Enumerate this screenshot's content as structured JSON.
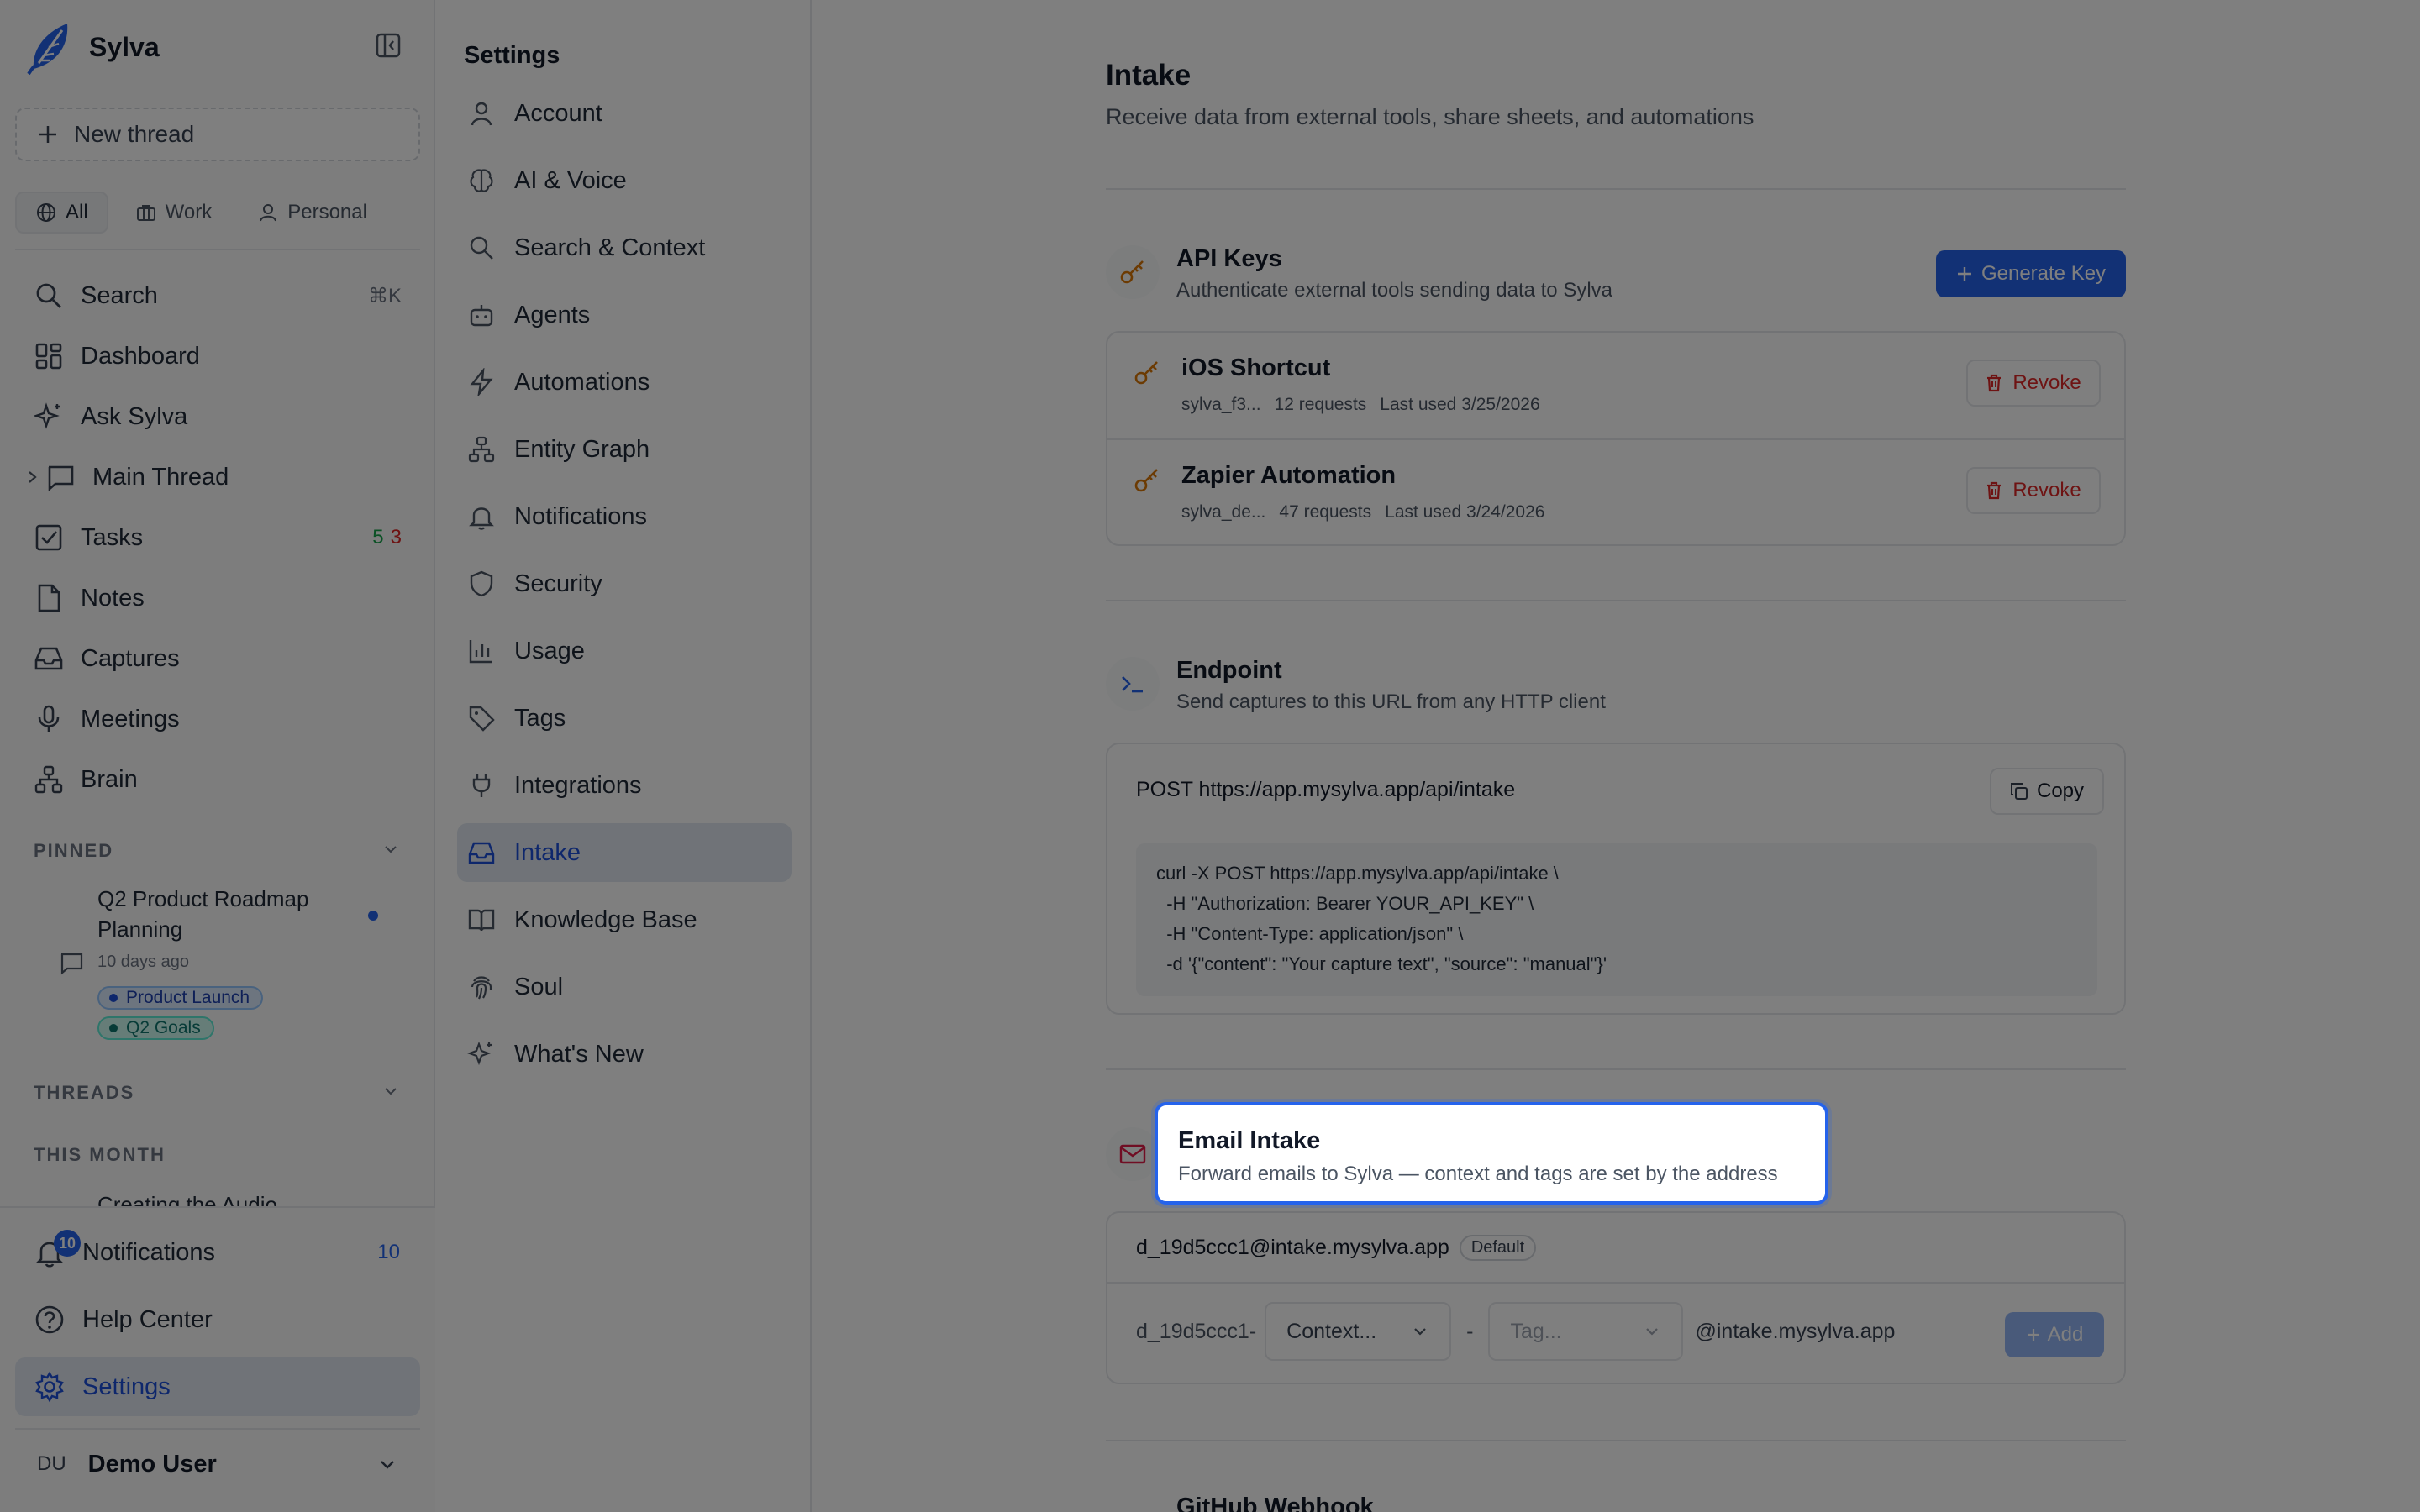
{
  "app": {
    "name": "Sylva"
  },
  "sidebar": {
    "new_thread_label": "New thread",
    "filters": [
      {
        "label": "All",
        "icon": "globe-icon",
        "active": true
      },
      {
        "label": "Work",
        "icon": "briefcase-icon",
        "active": false
      },
      {
        "label": "Personal",
        "icon": "person-icon",
        "active": false
      }
    ],
    "nav": [
      {
        "label": "Search",
        "icon": "search-icon",
        "shortcut": "⌘K"
      },
      {
        "label": "Dashboard",
        "icon": "dashboard-icon"
      },
      {
        "label": "Ask Sylva",
        "icon": "sparkles-icon"
      },
      {
        "label": "Main Thread",
        "icon": "chat-icon"
      },
      {
        "label": "Tasks",
        "icon": "checkbox-icon",
        "count_open": "5",
        "count_overdue": "3"
      },
      {
        "label": "Notes",
        "icon": "file-icon"
      },
      {
        "label": "Captures",
        "icon": "inbox-icon"
      },
      {
        "label": "Meetings",
        "icon": "mic-icon"
      },
      {
        "label": "Brain",
        "icon": "network-icon"
      }
    ],
    "pinned_label": "PINNED",
    "pinned_item": {
      "title": "Q2 Product Roadmap Planning",
      "date": "10 days ago",
      "tags": [
        "Product Launch",
        "Q2 Goals"
      ]
    },
    "threads_label": "THREADS",
    "this_month_label": "THIS MONTH",
    "thread_partial": "Creating the Audio",
    "bottom": {
      "notifications_label": "Notifications",
      "notifications_badge": "10",
      "notifications_count": "10",
      "help_label": "Help Center",
      "settings_label": "Settings"
    },
    "user": {
      "initials": "DU",
      "name": "Demo User"
    }
  },
  "settings_nav": {
    "title": "Settings",
    "items": [
      {
        "label": "Account",
        "icon": "user-icon"
      },
      {
        "label": "AI & Voice",
        "icon": "brain-icon"
      },
      {
        "label": "Search & Context",
        "icon": "search-icon"
      },
      {
        "label": "Agents",
        "icon": "bot-icon"
      },
      {
        "label": "Automations",
        "icon": "zap-icon"
      },
      {
        "label": "Entity Graph",
        "icon": "network-icon"
      },
      {
        "label": "Notifications",
        "icon": "bell-icon"
      },
      {
        "label": "Security",
        "icon": "shield-icon"
      },
      {
        "label": "Usage",
        "icon": "bar-chart-icon"
      },
      {
        "label": "Tags",
        "icon": "tag-icon"
      },
      {
        "label": "Integrations",
        "icon": "plug-icon"
      },
      {
        "label": "Intake",
        "icon": "inbox-icon",
        "active": true
      },
      {
        "label": "Knowledge Base",
        "icon": "book-icon"
      },
      {
        "label": "Soul",
        "icon": "fingerprint-icon"
      },
      {
        "label": "What's New",
        "icon": "sparkles-icon"
      }
    ]
  },
  "main": {
    "title": "Intake",
    "subtitle": "Receive data from external tools, share sheets, and automations",
    "api_keys": {
      "title": "API Keys",
      "subtitle": "Authenticate external tools sending data to Sylva",
      "generate_label": "Generate Key",
      "revoke_label": "Revoke",
      "keys": [
        {
          "name": "iOS Shortcut",
          "prefix": "sylva_f3...",
          "requests": "12 requests",
          "last_used": "Last used 3/25/2026"
        },
        {
          "name": "Zapier Automation",
          "prefix": "sylva_de...",
          "requests": "47 requests",
          "last_used": "Last used 3/24/2026"
        }
      ]
    },
    "endpoint": {
      "title": "Endpoint",
      "subtitle": "Send captures to this URL from any HTTP client",
      "url": "POST https://app.mysylva.app/api/intake",
      "copy_label": "Copy",
      "code": [
        "curl -X POST https://app.mysylva.app/api/intake \\",
        "  -H \"Authorization: Bearer YOUR_API_KEY\" \\",
        "  -H \"Content-Type: application/json\" \\",
        "  -d '{\"content\": \"Your capture text\", \"source\": \"manual\"}'"
      ]
    },
    "email_intake": {
      "title": "Email Intake",
      "subtitle": "Forward emails to Sylva — context and tags are set by the address",
      "default_address": "d_19d5ccc1@intake.mysylva.app",
      "default_badge": "Default",
      "prefix": "d_19d5ccc1-",
      "context_placeholder": "Context...",
      "separator": "-",
      "tag_placeholder": "Tag...",
      "domain": "@intake.mysylva.app",
      "add_label": "Add"
    },
    "github_partial": "GitHub Webhook"
  },
  "colors": {
    "accent": "#2563eb",
    "danger": "#dc2626",
    "key_icon": "#d97706",
    "email_icon": "#e11d48",
    "overlay": "rgba(0,0,0,0.5)"
  }
}
